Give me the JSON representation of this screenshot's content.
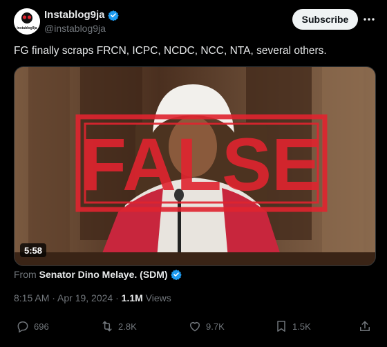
{
  "author": {
    "display_name": "Instablog9ja",
    "handle": "@instablog9ja",
    "avatar_text": "instablog9ja",
    "verified_color": "#1d9bf0"
  },
  "subscribe_label": "Subscribe",
  "tweet_text": "FG finally scraps FRCN, ICPC, NCDC, NCC, NTA, several others.",
  "media": {
    "type": "video",
    "duration": "5:58",
    "overlay_stamp": "FALSE",
    "stamp_color": "#e0242f"
  },
  "from": {
    "prefix": "From",
    "source": "Senator Dino Melaye. (SDM)"
  },
  "meta": {
    "timestamp": "8:15 AM · Apr 19, 2024 ·",
    "views_count": "1.1M",
    "views_label": "Views"
  },
  "actions": {
    "replies": "696",
    "reposts": "2.8K",
    "likes": "9.7K",
    "bookmarks": "1.5K"
  }
}
